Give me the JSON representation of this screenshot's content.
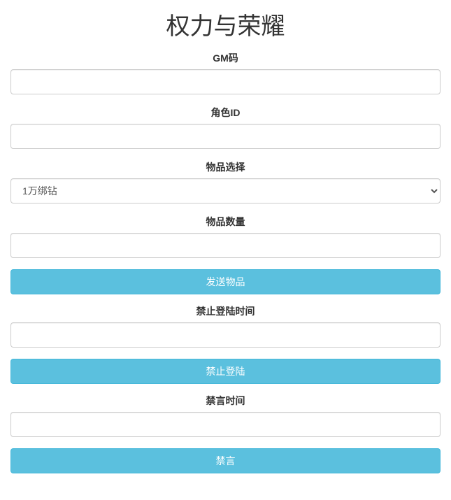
{
  "title": "权力与荣耀",
  "fields": {
    "gm_code": {
      "label": "GM码",
      "value": ""
    },
    "role_id": {
      "label": "角色ID",
      "value": ""
    },
    "item_select": {
      "label": "物品选择",
      "selected": "1万绑钻"
    },
    "item_qty": {
      "label": "物品数量",
      "value": ""
    },
    "ban_login_time": {
      "label": "禁止登陆时间",
      "value": ""
    },
    "mute_time": {
      "label": "禁言时间",
      "value": ""
    }
  },
  "buttons": {
    "send_item": "发送物品",
    "ban_login": "禁止登陆",
    "mute": "禁言"
  }
}
